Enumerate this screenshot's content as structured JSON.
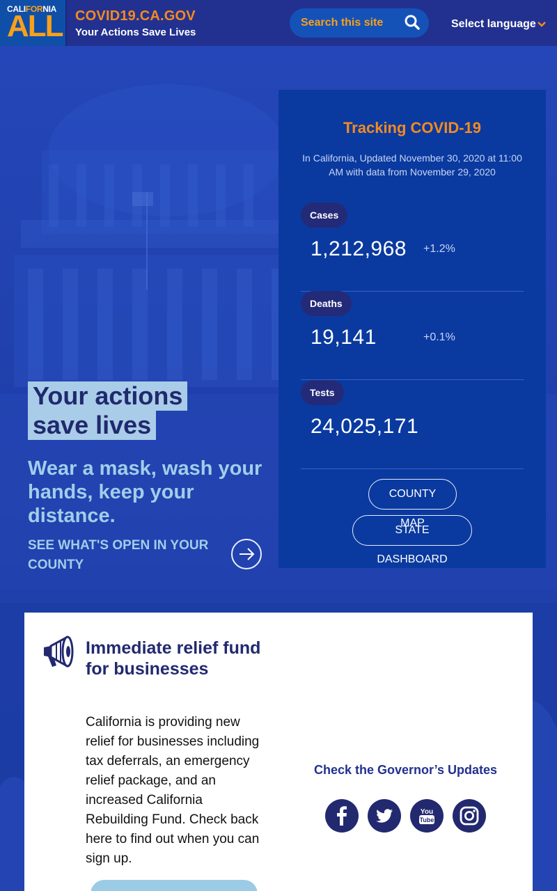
{
  "header": {
    "logo_top": "CALIFORNIA",
    "logo_top_a": "CALI",
    "logo_top_b": "FOR",
    "logo_top_c": "NIA",
    "logo_main": "ALL",
    "site_title": "COVID19.CA.GOV",
    "tagline": "Your Actions Save Lives",
    "search_placeholder": "Search this site",
    "language_label": "Select language"
  },
  "hero": {
    "headline_line1": "Your actions",
    "headline_line2": "save lives",
    "subheadline": "Wear a mask, wash your hands, keep your distance.",
    "link_text": "SEE WHAT'S OPEN IN YOUR COUNTY"
  },
  "tracking": {
    "title": "Tracking COVID-19",
    "updated": "In California, Updated November 30, 2020 at 11:00 AM with data from November 29, 2020",
    "stats": [
      {
        "label": "Cases",
        "value": "1,212,968",
        "change": "+1.2%"
      },
      {
        "label": "Deaths",
        "value": "19,141",
        "change": "+0.1%"
      },
      {
        "label": "Tests",
        "value": "24,025,171",
        "change": ""
      }
    ],
    "county_map_label": "COUNTY MAP",
    "state_dashboard_label": "STATE DASHBOARD"
  },
  "card": {
    "title": "Immediate relief fund for businesses",
    "body": "California is providing new relief for businesses including tax deferrals, an emergency relief package, and an increased California Rebuilding Fund. Check back here to find out when you can sign up.",
    "governor_title": "Check the Governor’s Updates",
    "social": [
      "facebook-icon",
      "twitter-icon",
      "youtube-icon",
      "instagram-icon"
    ]
  },
  "colors": {
    "accent_orange": "#f58a1f",
    "brand_blue": "#22318f",
    "panel_blue": "#0a3aa0",
    "light_blue": "#a3cdea"
  }
}
